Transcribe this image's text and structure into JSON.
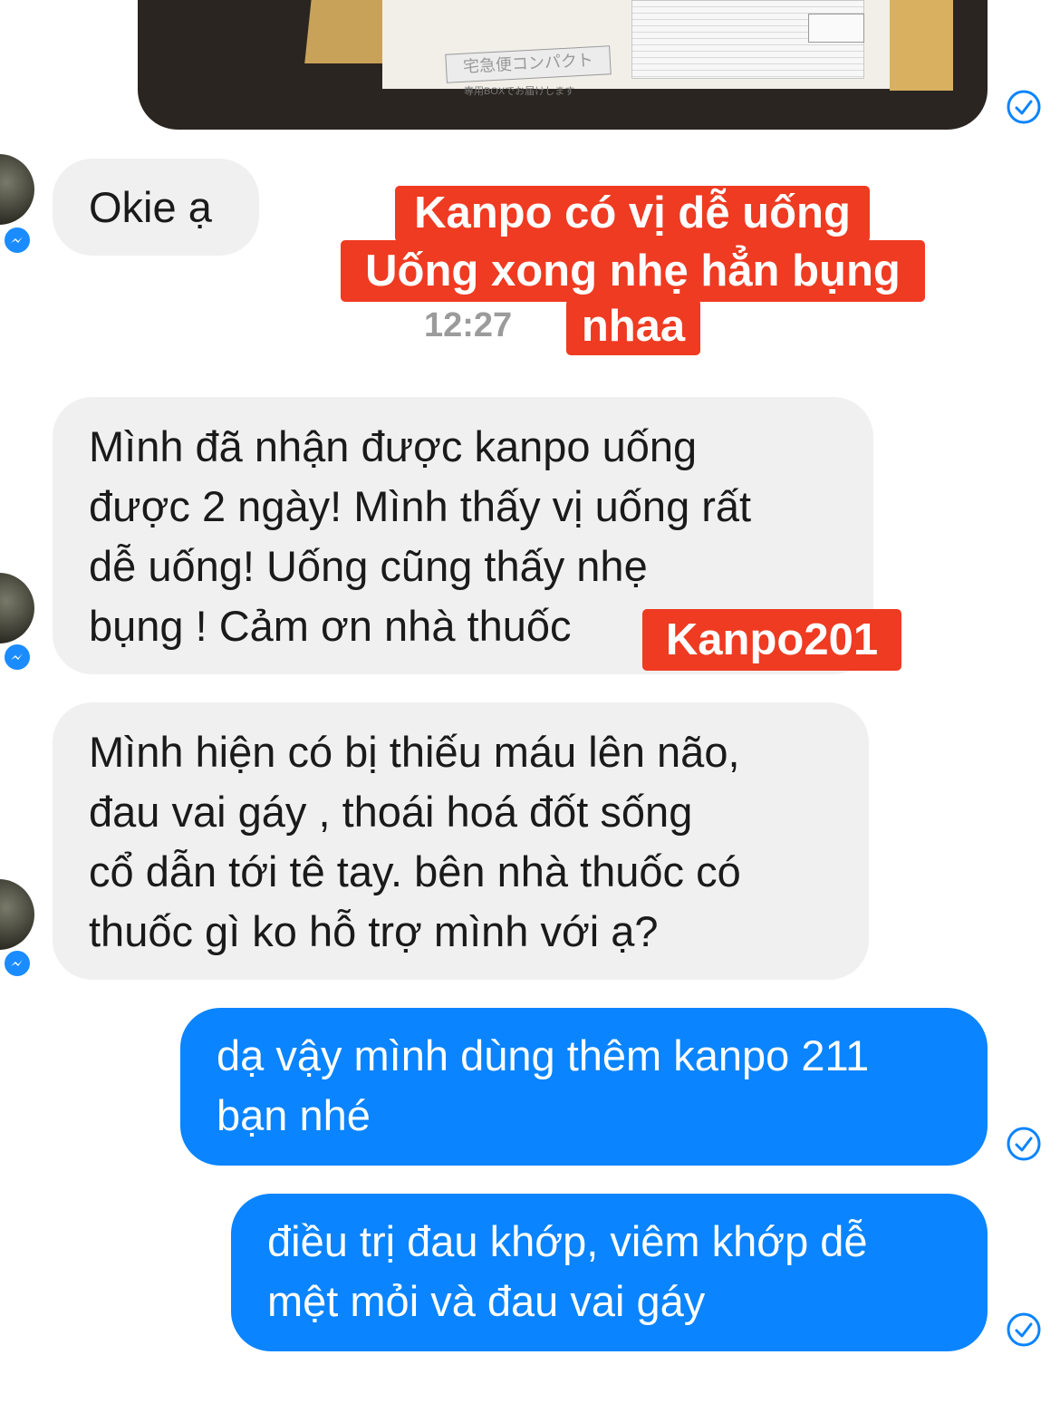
{
  "attachment": {
    "package_label": "宅急便コンパクト",
    "package_sub": "専用BOXでお届けします"
  },
  "messages": [
    {
      "id": "m1",
      "side": "incoming",
      "text": "Okie ạ"
    },
    {
      "id": "m2",
      "side": "incoming",
      "lines": [
        "Mình đã nhận được kanpo uống",
        "được 2 ngày! Mình thấy vị uống rất",
        "dễ uống! Uống cũng thấy nhẹ",
        "bụng ! Cảm ơn nhà thuốc"
      ]
    },
    {
      "id": "m3",
      "side": "incoming",
      "lines": [
        "Mình hiện có bị thiếu máu lên não,",
        "đau vai gáy , thoái hoá đốt sống",
        "cổ dẫn tới tê tay. bên nhà thuốc có",
        "thuốc gì ko hỗ trợ mình với ạ?"
      ]
    },
    {
      "id": "m4",
      "side": "outgoing",
      "lines": [
        "dạ vậy mình dùng thêm kanpo 211",
        "bạn nhé"
      ]
    },
    {
      "id": "m5",
      "side": "outgoing",
      "lines": [
        "điều trị đau khớp, viêm khớp dễ",
        "mệt  mỏi và đau vai gáy"
      ]
    }
  ],
  "timestamp": "12:27",
  "overlay": {
    "caption_lines": [
      "Kanpo có vị dễ uống",
      "Uống xong nhẹ hẳn bụng",
      "nhaa"
    ],
    "brand_tag": "Kanpo201"
  },
  "icons": {
    "read_receipt": "check-circle-icon",
    "messenger_badge": "messenger-icon",
    "accent": "#0a84ff",
    "overlay_color": "#ee3b22"
  }
}
